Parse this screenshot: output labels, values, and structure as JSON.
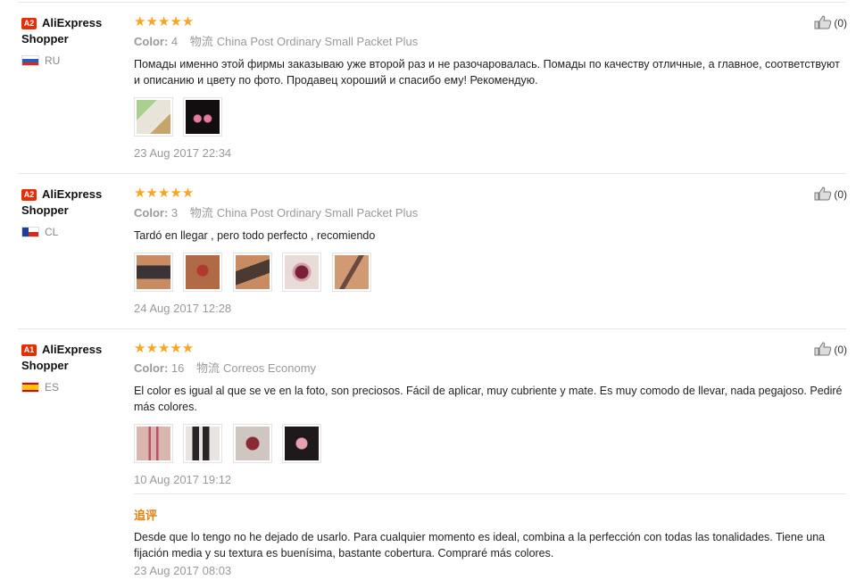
{
  "reviews": [
    {
      "level": "A2",
      "user": "AliExpress Shopper",
      "country": "RU",
      "flag": "flag-ru",
      "stars": "★★★★★",
      "color_label": "Color:",
      "color_value": "4",
      "ship_cn": "物流",
      "shipping": "China Post Ordinary Small Packet Plus",
      "text": "Помады именно этой фирмы заказываю уже второй раз и не разочаровалась. Помады по качеству отличные, а главное, соответствуют и описанию и цвету по фото. Продавец хороший и спасибо ему! Рекомендую.",
      "photos": [
        "#c8b07a",
        "#1a1418"
      ],
      "date": "23 Aug 2017 22:34",
      "likes": "(0)"
    },
    {
      "level": "A2",
      "user": "AliExpress Shopper",
      "country": "CL",
      "flag": "flag-cl",
      "stars": "★★★★★",
      "color_label": "Color:",
      "color_value": "3",
      "ship_cn": "物流",
      "shipping": "China Post Ordinary Small Packet Plus",
      "text": "Tardó en llegar , pero todo perfecto , recomiendo",
      "photos": [
        "#b06a45",
        "#a8603c",
        "#9c5a3a",
        "#b8786a",
        "#b6805a"
      ],
      "date": "24 Aug 2017 12:28",
      "likes": "(0)"
    },
    {
      "level": "A1",
      "user": "AliExpress Shopper",
      "country": "ES",
      "flag": "flag-es",
      "stars": "★★★★★",
      "color_label": "Color:",
      "color_value": "16",
      "ship_cn": "物流",
      "shipping": "Correos Economy",
      "text": "El color es igual al que se ve en la foto, son preciosos. Fácil de aplicar, muy cubriente y mate. Es muy comodo de llevar, nada pegajoso. Pediré más colores.",
      "photos": [
        "#d8b6ae",
        "#2a2426",
        "#8a6a60",
        "#1e1a1c"
      ],
      "date": "10 Aug 2017 19:12",
      "likes": "(0)",
      "followup": {
        "label": "追评",
        "text": "Desde que lo tengo no he dejado de usarlo. Para cualquier momento es ideal, combina a la perfección con todas las tonalidades. Tiene una fijación media y su textura es buenísima, bastante cobertura. Compraré más colores.",
        "date": "23 Aug 2017 08:03"
      }
    }
  ],
  "colors": {
    "accent_followup": "#e8810a",
    "star": "#f5a623",
    "level_badge": "#e62e04"
  }
}
